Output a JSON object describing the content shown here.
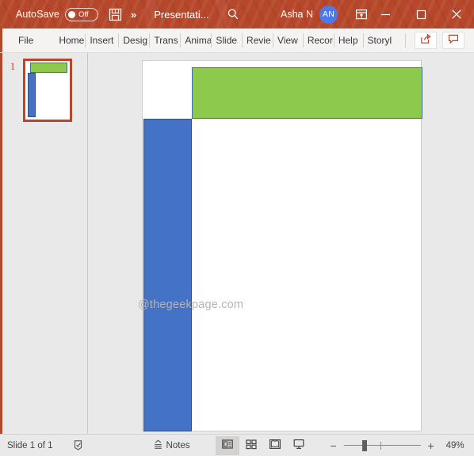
{
  "titlebar": {
    "autosave_label": "AutoSave",
    "autosave_state": "Off",
    "save_icon": "save-icon",
    "qat_more": "»",
    "doc_title": "Presentati...",
    "search_icon": "search-icon",
    "user_name": "Asha N",
    "avatar_initials": "AN",
    "ribbon_display_icon": "ribbon-display-options-icon",
    "minimize": "–",
    "maximize": "□",
    "close": "✕",
    "bg_color": "#b7472a"
  },
  "ribbon": {
    "tabs": [
      {
        "label": "File"
      },
      {
        "label": "Home"
      },
      {
        "label": "Insert"
      },
      {
        "label": "Desig"
      },
      {
        "label": "Trans"
      },
      {
        "label": "Anima"
      },
      {
        "label": "Slide"
      },
      {
        "label": "Revie"
      },
      {
        "label": "View"
      },
      {
        "label": "Recor"
      },
      {
        "label": "Help"
      },
      {
        "label": "Storyl"
      }
    ],
    "share_icon": "share-icon",
    "comments_icon": "comment-icon"
  },
  "thumbnails": {
    "slides": [
      {
        "number": "1"
      }
    ]
  },
  "slide": {
    "shapes": [
      {
        "name": "green-rectangle",
        "fill": "#8dc94d",
        "border": "#41719c"
      },
      {
        "name": "blue-rectangle",
        "fill": "#4472c4",
        "border": "#2f528f"
      }
    ]
  },
  "watermark": {
    "text": "@thegeekpage.com"
  },
  "statusbar": {
    "slide_count": "Slide 1 of 1",
    "accessibility_icon": "accessibility-checker-icon",
    "notes_label": "Notes",
    "notes_icon": "notes-icon",
    "views": [
      {
        "name": "normal-view",
        "icon": "normal-view-icon",
        "active": true
      },
      {
        "name": "slide-sorter-view",
        "icon": "slide-sorter-icon",
        "active": false
      },
      {
        "name": "reading-view",
        "icon": "reading-view-icon",
        "active": false
      },
      {
        "name": "slide-show-view",
        "icon": "slide-show-icon",
        "active": false
      }
    ],
    "zoom_out": "−",
    "zoom_in": "+",
    "zoom_level": "49%",
    "fit_icon": "fit-to-window-icon"
  }
}
